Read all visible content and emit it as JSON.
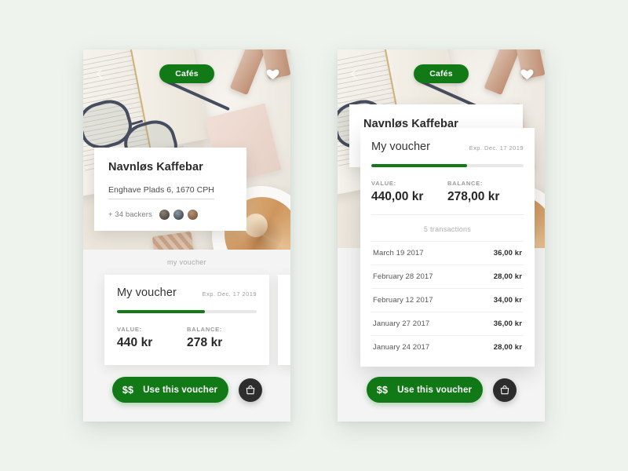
{
  "theme": {
    "background": "#eef3ee",
    "brand_green": "#117a16",
    "progress_green": "#147a17",
    "dark_button": "#2d2d2d",
    "card_white": "#ffffff",
    "frame_gray": "#f4f4f4"
  },
  "screen_one": {
    "hero": {
      "back_icon": "chevron-left-icon",
      "category_pill": "Cafés",
      "favorite_icon": "heart-icon"
    },
    "venue": {
      "name": "Navnløs Kaffebar",
      "address": "Enghave Plads 6, 1670 CPH",
      "backers_label": "+ 34 backers",
      "avatar_count": 3
    },
    "section_label": "my voucher",
    "voucher": {
      "title": "My voucher",
      "expiry": "Exp. Dec. 17 2019",
      "progress_percent": 63,
      "value_label": "VALUE:",
      "value_amount": "440 kr",
      "balance_label": "BALANCE:",
      "balance_amount": "278 kr"
    },
    "actions": {
      "money_icon": "$$",
      "use_label": "Use this voucher",
      "bag_icon": "shopping-bag-icon"
    }
  },
  "screen_two": {
    "hero": {
      "back_icon": "chevron-left-icon",
      "category_pill": "Cafés",
      "favorite_icon": "heart-icon"
    },
    "venue": {
      "name": "Navnløs Kaffebar"
    },
    "voucher": {
      "title": "My voucher",
      "expiry": "Exp. Dec. 17 2019",
      "progress_percent": 63,
      "value_label": "VALUE:",
      "value_amount": "440,00 kr",
      "balance_label": "BALANCE:",
      "balance_amount": "278,00 kr",
      "transactions_count_label": "5 transactions",
      "transactions": [
        {
          "date": "March 19 2017",
          "amount": "36,00 kr"
        },
        {
          "date": "February 28 2017",
          "amount": "28,00 kr"
        },
        {
          "date": "February 12 2017",
          "amount": "34,00 kr"
        },
        {
          "date": "January 27 2017",
          "amount": "36,00 kr"
        },
        {
          "date": "January 24 2017",
          "amount": "28,00 kr"
        }
      ]
    },
    "actions": {
      "money_icon": "$$",
      "use_label": "Use this voucher",
      "bag_icon": "shopping-bag-icon"
    }
  }
}
